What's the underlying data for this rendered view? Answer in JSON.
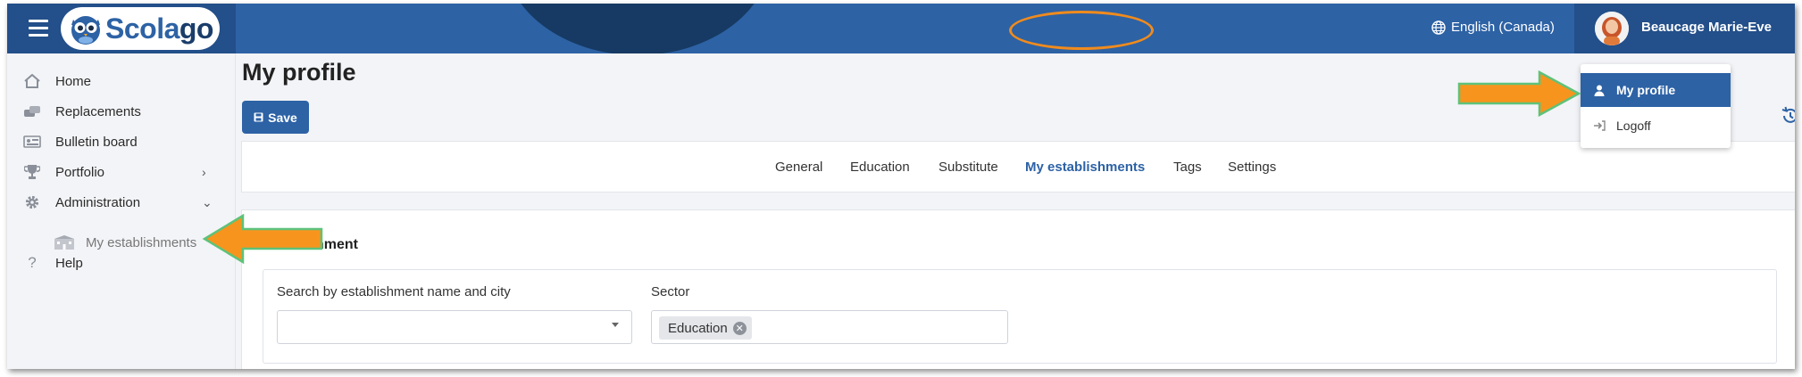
{
  "app": {
    "logo_text_a": "Scola",
    "logo_text_b": "go"
  },
  "header": {
    "language": "English (Canada)",
    "user_name": "Beaucage Marie-Eve"
  },
  "user_menu": [
    {
      "label": "My profile",
      "icon": "user-icon",
      "active": true
    },
    {
      "label": "Logoff",
      "icon": "logoff-icon",
      "active": false
    }
  ],
  "sidebar": {
    "items": [
      {
        "label": "Home",
        "icon": "home-icon"
      },
      {
        "label": "Replacements",
        "icon": "replacements-icon"
      },
      {
        "label": "Bulletin board",
        "icon": "bulletin-board-icon"
      },
      {
        "label": "Portfolio",
        "icon": "trophy-icon",
        "chevron": "›"
      },
      {
        "label": "Administration",
        "icon": "gear-icon",
        "chevron": "⌄"
      },
      {
        "label": "Help",
        "icon": "help-icon"
      }
    ],
    "sub_item": {
      "label": "My establishments",
      "icon": "establishments-icon"
    }
  },
  "page": {
    "title": "My profile",
    "save_label": "Save"
  },
  "tabs": [
    "General",
    "Education",
    "Substitute",
    "My establishments",
    "Tags",
    "Settings"
  ],
  "active_tab": "My establishments",
  "section": {
    "title_visible": "hment",
    "search_label": "Search by establishment name and city",
    "search_value": "",
    "sector_label": "Sector",
    "sector_chip": "Education"
  },
  "colors": {
    "primary": "#2d62a5",
    "annotation_arrow": "#f7941d",
    "annotation_border": "#5ec27a",
    "highlight_ring": "#f08b1d"
  }
}
